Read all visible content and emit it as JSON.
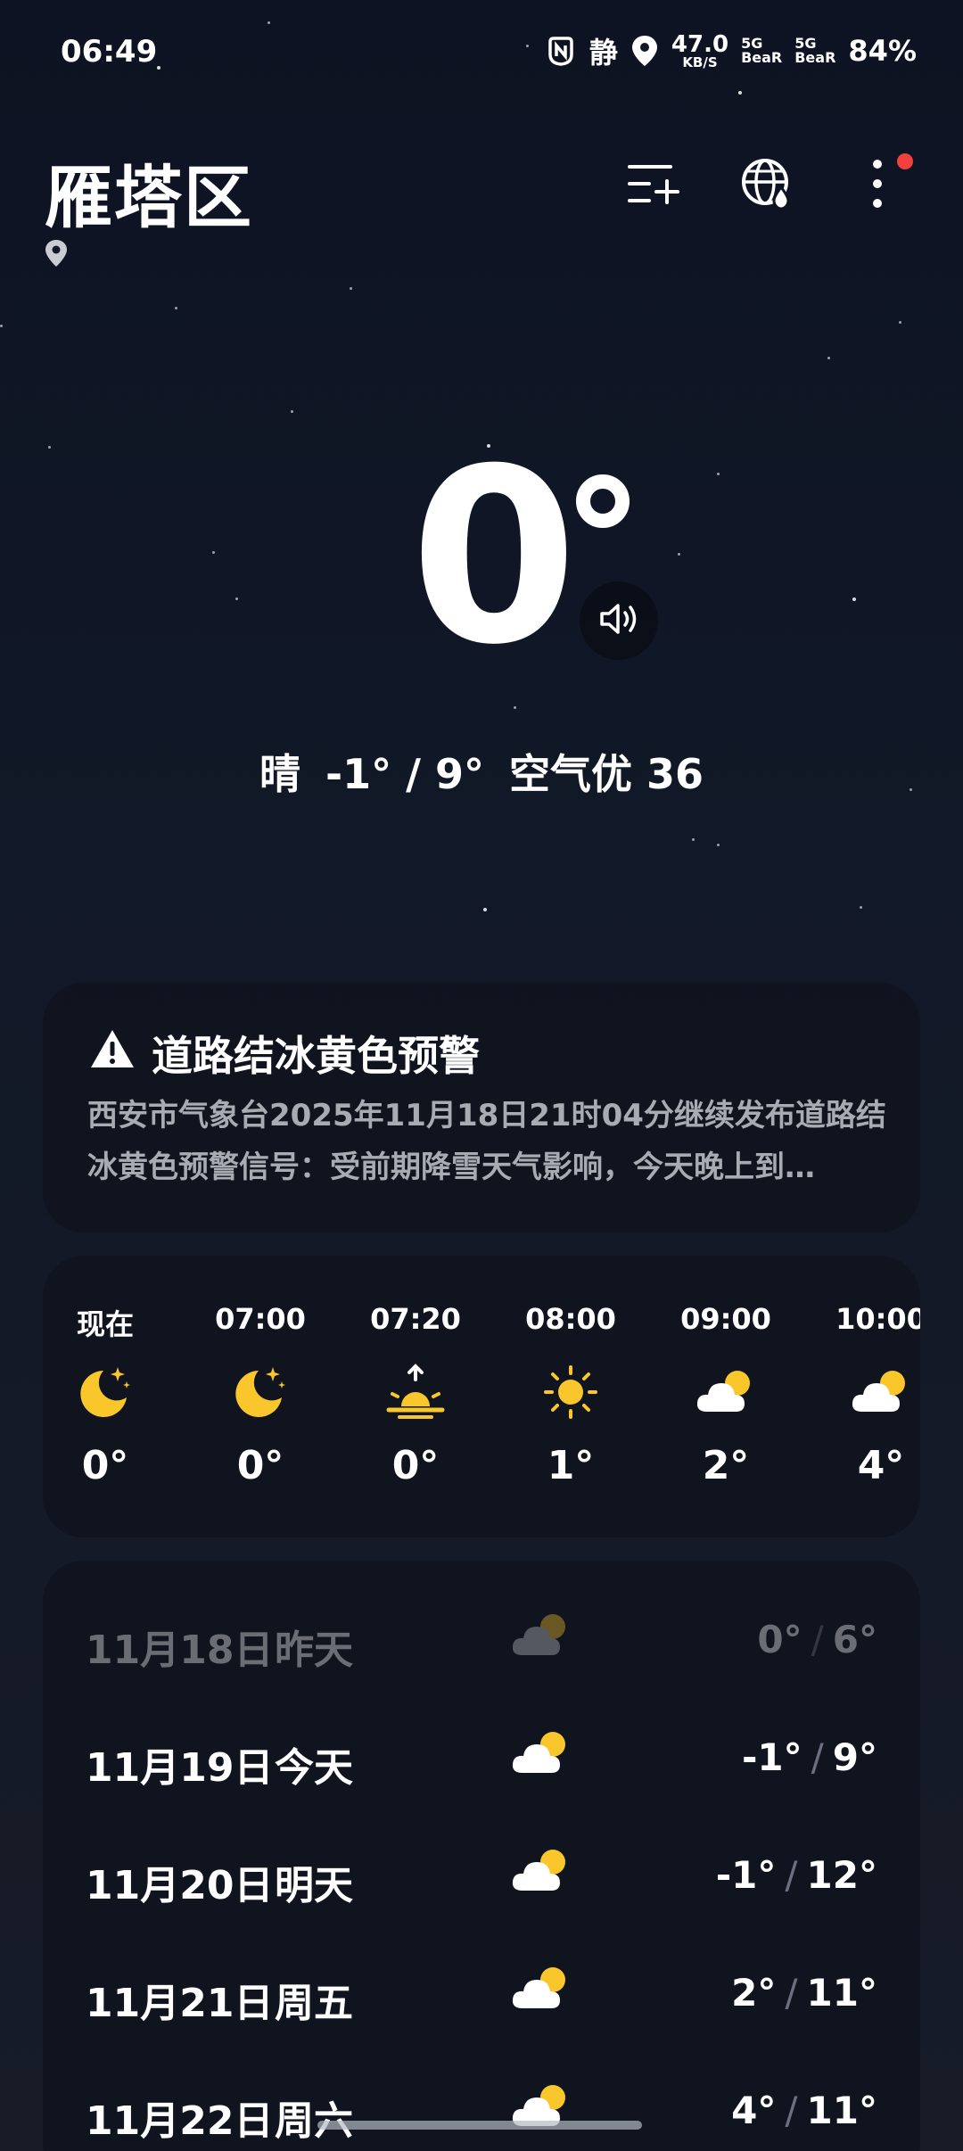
{
  "status_bar": {
    "time": "06:49",
    "mute_label": "静",
    "net_speed_value": "47.0",
    "net_speed_unit": "KB/S",
    "sim1_label": "5G",
    "sim1_sub": "BeaR",
    "sim2_label": "5G",
    "sim2_sub": "BeaR",
    "battery": "84%"
  },
  "header": {
    "city": "雁塔区",
    "icons": [
      "location-pin-icon",
      "add-city-icon",
      "globe-drop-icon",
      "more-vertical-icon"
    ]
  },
  "current": {
    "temperature": "0",
    "condition": "晴",
    "range": "-1° / 9°",
    "air_quality": "空气优 36"
  },
  "warning": {
    "title": "道路结冰黄色预警",
    "body": "西安市气象台2025年11月18日21时04分继续发布道路结冰黄色预警信号：受前期降雪天气影响，今天晚上到…"
  },
  "hourly": [
    {
      "time": "现在",
      "icon": "moon-stars-icon",
      "temp": "0°"
    },
    {
      "time": "07:00",
      "icon": "moon-stars-icon",
      "temp": "0°"
    },
    {
      "time": "07:20",
      "icon": "sunrise-icon",
      "temp": "0°"
    },
    {
      "time": "08:00",
      "icon": "sun-icon",
      "temp": "1°"
    },
    {
      "time": "09:00",
      "icon": "partly-cloudy-icon",
      "temp": "2°"
    },
    {
      "time": "10:00",
      "icon": "partly-cloudy-icon",
      "temp": "4°"
    }
  ],
  "daily": [
    {
      "date": "11月18日",
      "day": "昨天",
      "icon": "partly-cloudy-icon",
      "low": "0°",
      "high": "6°"
    },
    {
      "date": "11月19日",
      "day": "今天",
      "icon": "partly-cloudy-icon",
      "low": "-1°",
      "high": "9°"
    },
    {
      "date": "11月20日",
      "day": "明天",
      "icon": "partly-cloudy-icon",
      "low": "-1°",
      "high": "12°"
    },
    {
      "date": "11月21日",
      "day": "周五",
      "icon": "partly-cloudy-icon",
      "low": "2°",
      "high": "11°"
    },
    {
      "date": "11月22日",
      "day": "周六",
      "icon": "partly-cloudy-icon",
      "low": "4°",
      "high": "11°"
    }
  ],
  "colors": {
    "background": "#0d1322",
    "card": "#10141e",
    "accent_yellow": "#f9c62b",
    "alert_red": "#f0413f",
    "secondary_text": "#a7abb2"
  }
}
